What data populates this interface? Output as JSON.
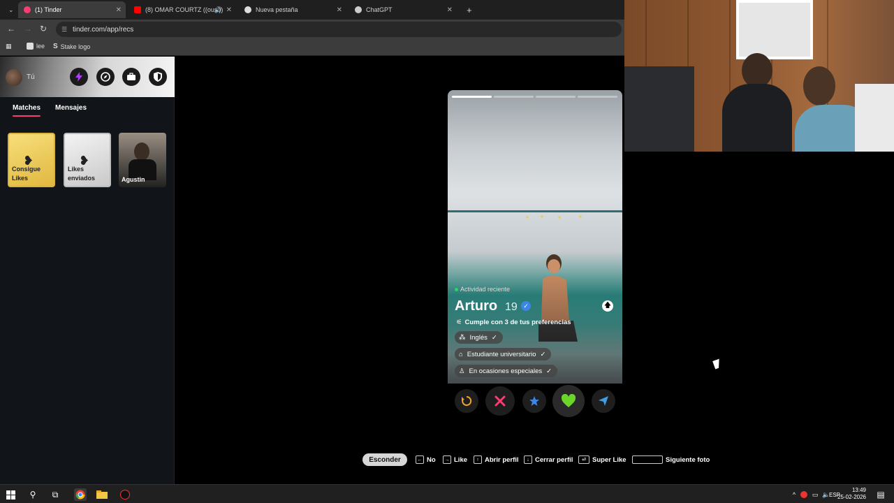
{
  "browser": {
    "tabs": [
      {
        "title": "(1) Tinder",
        "active": true
      },
      {
        "title": "(8) OMAR COURTZ ((ousi))",
        "active": false
      },
      {
        "title": "Nueva pestaña",
        "active": false
      },
      {
        "title": "ChatGPT",
        "active": false
      }
    ],
    "new_tab": "+",
    "url": "tinder.com/app/recs",
    "bookmarks": [
      "lee",
      "Stake logo"
    ]
  },
  "sidebar": {
    "me_label": "Tú",
    "tabs": [
      "Matches",
      "Mensajes"
    ],
    "cards": [
      {
        "label": "Consigue Likes"
      },
      {
        "label": "Likes enviados"
      },
      {
        "label": "Agustin"
      }
    ]
  },
  "profile": {
    "activity": "Actividad reciente",
    "name": "Arturo",
    "age": "19",
    "preferences": "Cumple con 3 de tus preferencias",
    "chips": [
      "Inglés",
      "Estudiante universitario",
      "En ocasiones especiales"
    ],
    "photo_count": 4,
    "current_photo": 1
  },
  "shortcuts": {
    "hide": "Esconder",
    "no": "No",
    "like": "Like",
    "open": "Abrir perfil",
    "close": "Cerrar perfil",
    "super": "Super Like",
    "next": "Siguiente foto"
  },
  "taskbar": {
    "lang": "ESP",
    "time": "13:49",
    "date": "25-02-2026"
  },
  "colors": {
    "tinder_pink": "#fe3c72",
    "like_green": "#6cd52a",
    "super_blue": "#3c86e6",
    "rewind_gold": "#f5a623"
  }
}
